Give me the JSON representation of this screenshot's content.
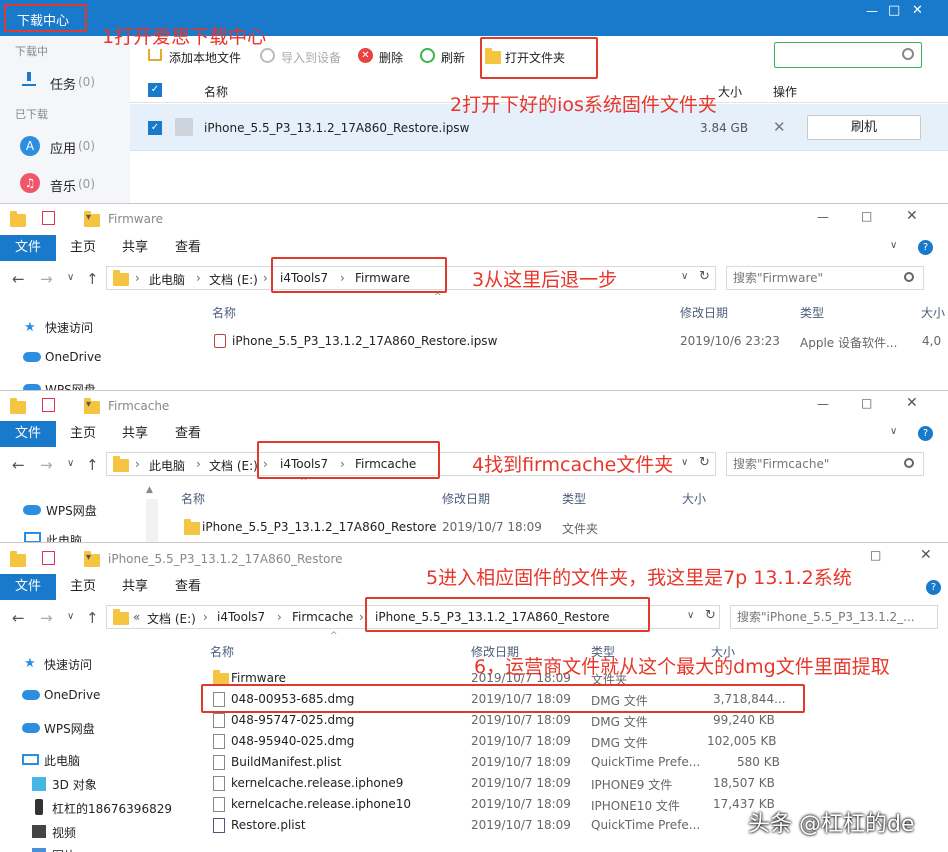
{
  "dl": {
    "title": "下载中心",
    "side_sections": [
      "下载中",
      "已下载"
    ],
    "side_items": [
      {
        "label": "任务",
        "count": "(0)"
      },
      {
        "label": "应用",
        "count": "(0)"
      },
      {
        "label": "音乐",
        "count": "(0)"
      }
    ],
    "toolbar": [
      "添加本地文件",
      "导入到设备",
      "删除",
      "刷新",
      "打开文件夹"
    ],
    "col_name": "名称",
    "col_size": "大小",
    "col_ops": "操作",
    "file_name": "iPhone_5.5_P3_13.1.2_17A860_Restore.ipsw",
    "file_size": "3.84 GB",
    "flash_btn": "刷机",
    "win_min": "—",
    "win_max": "□",
    "win_close": "✕"
  },
  "w1": {
    "title": "Firmware",
    "tabs": [
      "文件",
      "主页",
      "共享",
      "查看"
    ],
    "crumbs": [
      "此电脑",
      "文档 (E:)",
      "i4Tools7",
      "Firmware"
    ],
    "search": "搜索\"Firmware\"",
    "nav": [
      "快速访问",
      "OneDrive",
      "WPS网盘"
    ],
    "cols": [
      "名称",
      "修改日期",
      "类型",
      "大小"
    ],
    "file": {
      "name": "iPhone_5.5_P3_13.1.2_17A860_Restore.ipsw",
      "date": "2019/10/6 23:23",
      "type": "Apple 设备软件...",
      "size": "4,0"
    }
  },
  "w2": {
    "title": "Firmcache",
    "tabs": [
      "文件",
      "主页",
      "共享",
      "查看"
    ],
    "crumbs": [
      "此电脑",
      "文档 (E:)",
      "i4Tools7",
      "Firmcache"
    ],
    "search": "搜索\"Firmcache\"",
    "nav": [
      "WPS网盘",
      "此电脑"
    ],
    "cols": [
      "名称",
      "修改日期",
      "类型",
      "大小"
    ],
    "file": {
      "name": "iPhone_5.5_P3_13.1.2_17A860_Restore",
      "date": "2019/10/7 18:09",
      "type": "文件夹"
    }
  },
  "w3": {
    "title": "iPhone_5.5_P3_13.1.2_17A860_Restore",
    "tabs": [
      "文件",
      "主页",
      "共享",
      "查看"
    ],
    "crumbs_prefix": "«",
    "crumbs": [
      "文档 (E:)",
      "i4Tools7",
      "Firmcache",
      "iPhone_5.5_P3_13.1.2_17A860_Restore"
    ],
    "search": "搜索\"iPhone_5.5_P3_13.1.2_...",
    "nav": [
      "快速访问",
      "OneDrive",
      "WPS网盘",
      "此电脑",
      "3D 对象",
      "杠杠的18676396829",
      "视频",
      "图片"
    ],
    "cols": [
      "名称",
      "修改日期",
      "类型",
      "大小"
    ],
    "files": [
      {
        "name": "Firmware",
        "date": "2019/10/7 18:09",
        "type": "文件夹",
        "size": ""
      },
      {
        "name": "048-00953-685.dmg",
        "date": "2019/10/7 18:09",
        "type": "DMG 文件",
        "size": "3,718,844..."
      },
      {
        "name": "048-95747-025.dmg",
        "date": "2019/10/7 18:09",
        "type": "DMG 文件",
        "size": "99,240 KB"
      },
      {
        "name": "048-95940-025.dmg",
        "date": "2019/10/7 18:09",
        "type": "DMG 文件",
        "size": "102,005 KB"
      },
      {
        "name": "BuildManifest.plist",
        "date": "2019/10/7 18:09",
        "type": "QuickTime Prefe...",
        "size": "580 KB"
      },
      {
        "name": "kernelcache.release.iphone9",
        "date": "2019/10/7 18:09",
        "type": "IPHONE9 文件",
        "size": "18,507 KB"
      },
      {
        "name": "kernelcache.release.iphone10",
        "date": "2019/10/7 18:09",
        "type": "IPHONE10 文件",
        "size": "17,437 KB"
      },
      {
        "name": "Restore.plist",
        "date": "2019/10/7 18:09",
        "type": "QuickTime Prefe...",
        "size": ""
      }
    ]
  },
  "annotations": {
    "a1": "1打开爱思下载中心",
    "a2": "2打开下好的ios系统固件文件夹",
    "a3": "3从这里后退一步",
    "a4": "4找到firmcache文件夹",
    "a5": "5进入相应固件的文件夹，我这里是7p 13.1.2系统",
    "a6": "6，运营商文件就从这个最大的dmg文件里面提取"
  },
  "watermark": "头条 @杠杠的de",
  "colors": {
    "accent": "#1979ca",
    "annotation": "#e8362a",
    "selected_row": "#e5f0fb"
  }
}
